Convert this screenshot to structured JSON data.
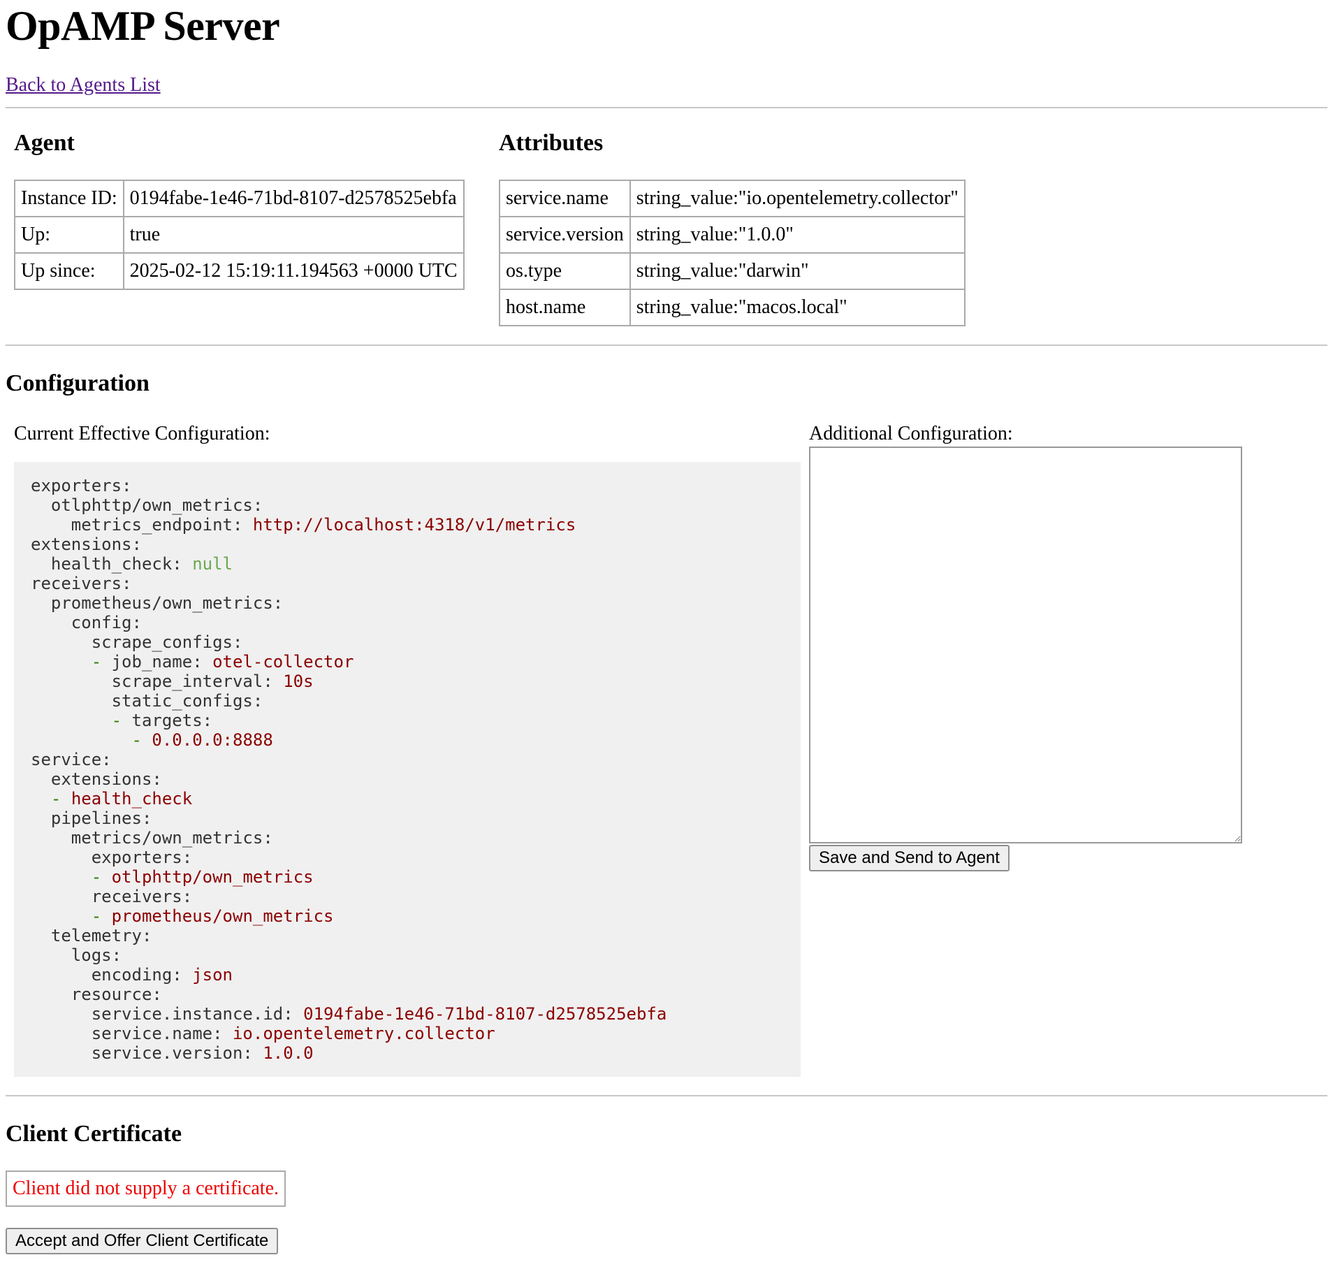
{
  "header": {
    "title": "OpAMP Server",
    "back_link": "Back to Agents List"
  },
  "agent": {
    "heading": "Agent",
    "rows": [
      {
        "key": "Instance ID:",
        "value": "0194fabe-1e46-71bd-8107-d2578525ebfa"
      },
      {
        "key": "Up:",
        "value": "true"
      },
      {
        "key": "Up since:",
        "value": "2025-02-12 15:19:11.194563 +0000 UTC"
      }
    ]
  },
  "attributes": {
    "heading": "Attributes",
    "rows": [
      {
        "key": "service.name",
        "value": "string_value:\"io.opentelemetry.collector\""
      },
      {
        "key": "service.version",
        "value": "string_value:\"1.0.0\""
      },
      {
        "key": "os.type",
        "value": "string_value:\"darwin\""
      },
      {
        "key": "host.name",
        "value": "string_value:\"macos.local\""
      }
    ]
  },
  "configuration": {
    "heading": "Configuration",
    "current_label": "Current Effective Configuration:",
    "additional_label": "Additional Configuration:",
    "additional_value": "",
    "save_button": "Save and Send to Agent",
    "yaml_lines": [
      [
        {
          "t": "exporters:",
          "c": "k"
        }
      ],
      [
        {
          "t": "  otlphttp/own_metrics:",
          "c": "k"
        }
      ],
      [
        {
          "t": "    metrics_endpoint: ",
          "c": "k"
        },
        {
          "t": "http://localhost:4318/v1/metrics",
          "c": "s"
        }
      ],
      [
        {
          "t": "extensions:",
          "c": "k"
        }
      ],
      [
        {
          "t": "  health_check: ",
          "c": "k"
        },
        {
          "t": "null",
          "c": "n"
        }
      ],
      [
        {
          "t": "receivers:",
          "c": "k"
        }
      ],
      [
        {
          "t": "  prometheus/own_metrics:",
          "c": "k"
        }
      ],
      [
        {
          "t": "    config:",
          "c": "k"
        }
      ],
      [
        {
          "t": "      scrape_configs:",
          "c": "k"
        }
      ],
      [
        {
          "t": "      ",
          "c": "k"
        },
        {
          "t": "- ",
          "c": "d"
        },
        {
          "t": "job_name: ",
          "c": "k"
        },
        {
          "t": "otel-collector",
          "c": "s"
        }
      ],
      [
        {
          "t": "        scrape_interval: ",
          "c": "k"
        },
        {
          "t": "10s",
          "c": "s"
        }
      ],
      [
        {
          "t": "        static_configs:",
          "c": "k"
        }
      ],
      [
        {
          "t": "        ",
          "c": "k"
        },
        {
          "t": "- ",
          "c": "d"
        },
        {
          "t": "targets:",
          "c": "k"
        }
      ],
      [
        {
          "t": "          ",
          "c": "k"
        },
        {
          "t": "- ",
          "c": "d"
        },
        {
          "t": "0.0.0.0:8888",
          "c": "s"
        }
      ],
      [
        {
          "t": "service:",
          "c": "k"
        }
      ],
      [
        {
          "t": "  extensions:",
          "c": "k"
        }
      ],
      [
        {
          "t": "  ",
          "c": "k"
        },
        {
          "t": "- ",
          "c": "d"
        },
        {
          "t": "health_check",
          "c": "s"
        }
      ],
      [
        {
          "t": "  pipelines:",
          "c": "k"
        }
      ],
      [
        {
          "t": "    metrics/own_metrics:",
          "c": "k"
        }
      ],
      [
        {
          "t": "      exporters:",
          "c": "k"
        }
      ],
      [
        {
          "t": "      ",
          "c": "k"
        },
        {
          "t": "- ",
          "c": "d"
        },
        {
          "t": "otlphttp/own_metrics",
          "c": "s"
        }
      ],
      [
        {
          "t": "      receivers:",
          "c": "k"
        }
      ],
      [
        {
          "t": "      ",
          "c": "k"
        },
        {
          "t": "- ",
          "c": "d"
        },
        {
          "t": "prometheus/own_metrics",
          "c": "s"
        }
      ],
      [
        {
          "t": "  telemetry:",
          "c": "k"
        }
      ],
      [
        {
          "t": "    logs:",
          "c": "k"
        }
      ],
      [
        {
          "t": "      encoding: ",
          "c": "k"
        },
        {
          "t": "json",
          "c": "s"
        }
      ],
      [
        {
          "t": "    resource:",
          "c": "k"
        }
      ],
      [
        {
          "t": "      service.instance.id: ",
          "c": "k"
        },
        {
          "t": "0194fabe-1e46-71bd-8107-d2578525ebfa",
          "c": "s"
        }
      ],
      [
        {
          "t": "      service.name: ",
          "c": "k"
        },
        {
          "t": "io.opentelemetry.collector",
          "c": "s"
        }
      ],
      [
        {
          "t": "      service.version: ",
          "c": "k"
        },
        {
          "t": "1.0.0",
          "c": "s"
        }
      ]
    ]
  },
  "client_certificate": {
    "heading": "Client Certificate",
    "message": "Client did not supply a certificate.",
    "accept_button": "Accept and Offer Client Certificate",
    "message_color": "#ee0000"
  },
  "colors": {
    "link": "#551a8b",
    "yaml_string": "#8b0000",
    "yaml_dash": "#2e7d00",
    "yaml_null": "#6aa84f",
    "code_background": "#f0f0f0"
  }
}
